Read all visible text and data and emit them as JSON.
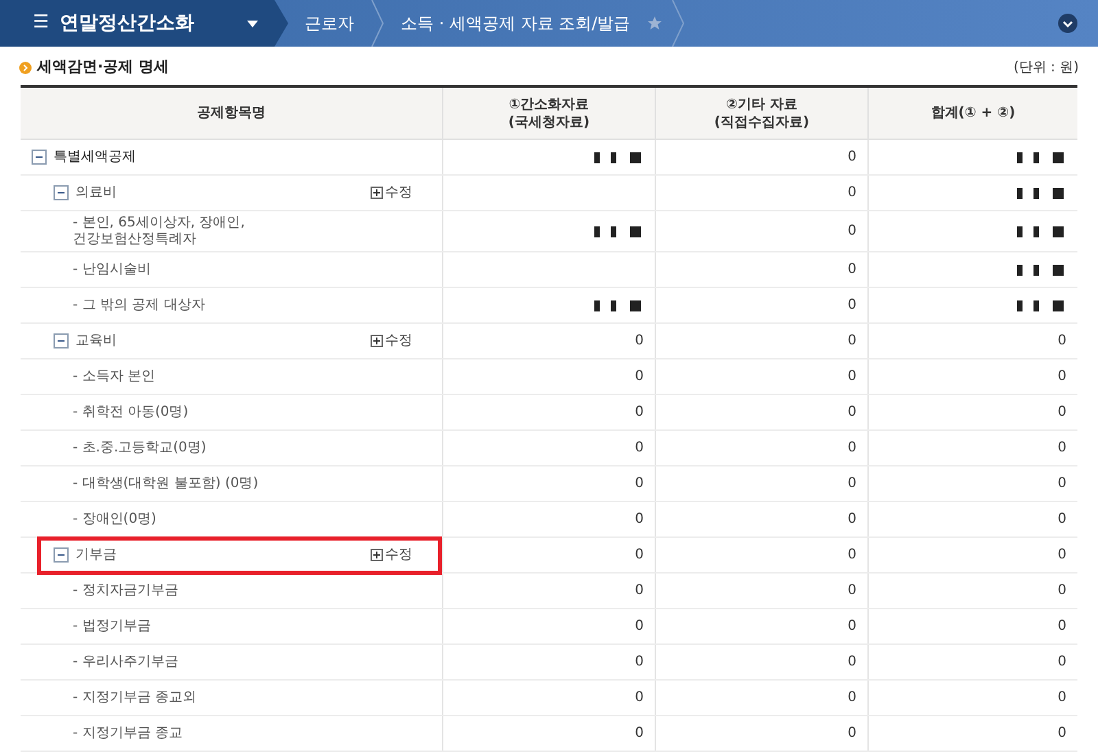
{
  "topbar": {
    "menu_icon": "☰",
    "title": "연말정산간소화",
    "breadcrumbs": [
      "근로자",
      "소득 · 세액공제 자료 조회/발급"
    ],
    "favorite": false
  },
  "section": {
    "title": "세액감면·공제 명세",
    "unit": "(단위 : 원)"
  },
  "table": {
    "columns": [
      "공제항목명",
      "①간소화자료\n(국세청자료)",
      "②기타 자료\n(직접수집자료)",
      "합계(① + ②)"
    ],
    "rows": [
      {
        "label": "특별세액공제",
        "expanded": true,
        "nts_redacted": true,
        "other": "0",
        "total_redacted": true,
        "children": [
          {
            "label": "의료비",
            "expanded": true,
            "edit": "수정",
            "other": "0",
            "total_redacted": true,
            "children": [
              {
                "label": "- 본인, 65세이상자, 장애인,\n건강보험산정특례자",
                "nts_redacted": true,
                "other": "0",
                "total_redacted": true
              },
              {
                "label": "- 난임시술비",
                "other": "0",
                "total_redacted": true
              },
              {
                "label": "- 그 밖의 공제 대상자",
                "nts_redacted": true,
                "other": "0",
                "total_redacted": true
              }
            ]
          },
          {
            "label": "교육비",
            "expanded": true,
            "edit": "수정",
            "nts": "0",
            "other": "0",
            "total": "0",
            "children": [
              {
                "label": "- 소득자 본인",
                "nts": "0",
                "other": "0",
                "total": "0"
              },
              {
                "label": "- 취학전 아동(0명)",
                "nts": "0",
                "other": "0",
                "total": "0"
              },
              {
                "label": "- 초.중.고등학교(0명)",
                "nts": "0",
                "other": "0",
                "total": "0"
              },
              {
                "label": "- 대학생(대학원 불포함) (0명)",
                "nts": "0",
                "other": "0",
                "total": "0"
              },
              {
                "label": "- 장애인(0명)",
                "nts": "0",
                "other": "0",
                "total": "0"
              }
            ]
          },
          {
            "label": "기부금",
            "expanded": true,
            "edit": "수정",
            "highlighted": true,
            "nts": "0",
            "other": "0",
            "total": "0",
            "children": [
              {
                "label": "- 정치자금기부금",
                "nts": "0",
                "other": "0",
                "total": "0"
              },
              {
                "label": "- 법정기부금",
                "nts": "0",
                "other": "0",
                "total": "0"
              },
              {
                "label": "- 우리사주기부금",
                "nts": "0",
                "other": "0",
                "total": "0"
              },
              {
                "label": "- 지정기부금 종교외",
                "nts": "0",
                "other": "0",
                "total": "0"
              },
              {
                "label": "- 지정기부금 종교",
                "nts": "0",
                "other": "0",
                "total": "0"
              }
            ]
          }
        ]
      }
    ]
  }
}
